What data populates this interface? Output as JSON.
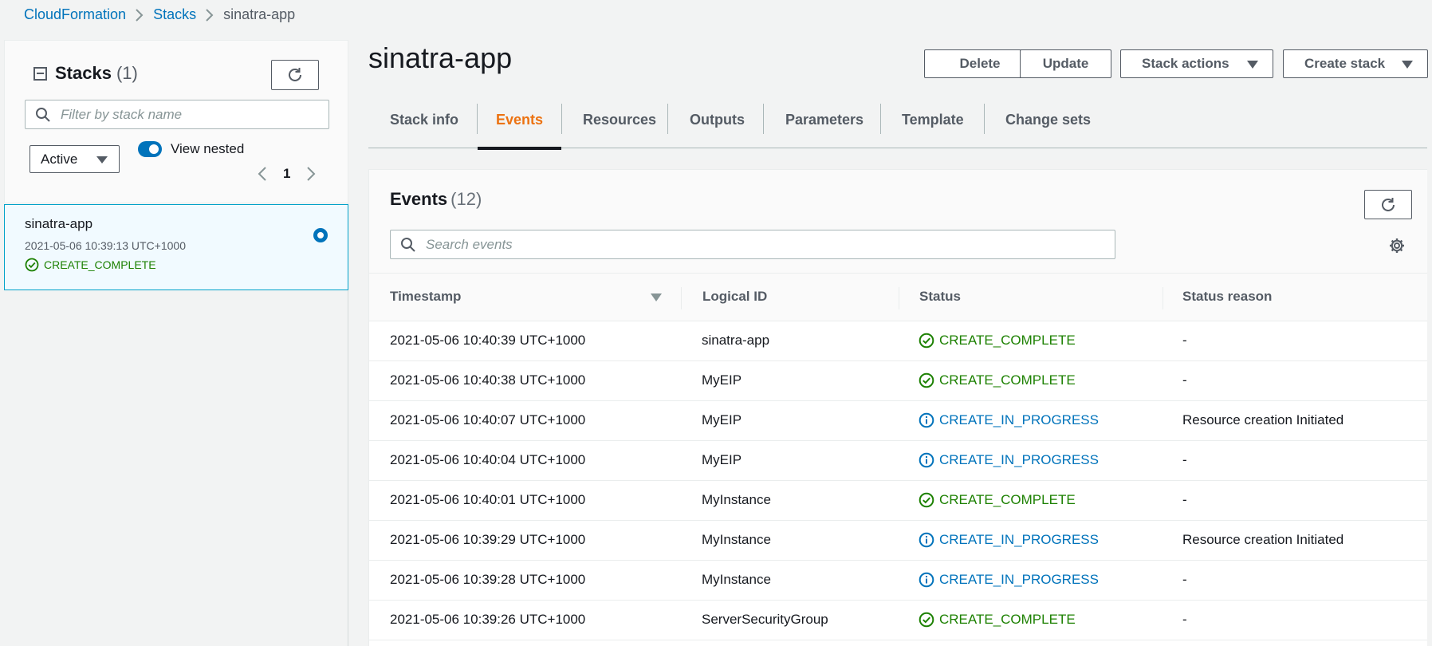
{
  "breadcrumb": {
    "items": [
      "CloudFormation",
      "Stacks",
      "sinatra-app"
    ]
  },
  "sidebar": {
    "title": "Stacks",
    "count": "(1)",
    "search_placeholder": "Filter by stack name",
    "filter_value": "Active",
    "toggle_label": "View nested",
    "toggle_on": true,
    "page_number": "1",
    "stack": {
      "name": "sinatra-app",
      "date": "2021-05-06 10:39:13 UTC+1000",
      "status": "CREATE_COMPLETE",
      "selected": true
    }
  },
  "header": {
    "title": "sinatra-app",
    "buttons": {
      "delete": "Delete",
      "update": "Update",
      "stack_actions": "Stack actions",
      "create_stack": "Create stack"
    }
  },
  "tabs": [
    "Stack info",
    "Events",
    "Resources",
    "Outputs",
    "Parameters",
    "Template",
    "Change sets"
  ],
  "active_tab": "Events",
  "events": {
    "title": "Events",
    "count": "(12)",
    "search_placeholder": "Search events",
    "columns": [
      "Timestamp",
      "Logical ID",
      "Status",
      "Status reason"
    ],
    "rows": [
      {
        "timestamp": "2021-05-06 10:40:39 UTC+1000",
        "logical_id": "sinatra-app",
        "status": "CREATE_COMPLETE",
        "reason": "-"
      },
      {
        "timestamp": "2021-05-06 10:40:38 UTC+1000",
        "logical_id": "MyEIP",
        "status": "CREATE_COMPLETE",
        "reason": "-"
      },
      {
        "timestamp": "2021-05-06 10:40:07 UTC+1000",
        "logical_id": "MyEIP",
        "status": "CREATE_IN_PROGRESS",
        "reason": "Resource creation Initiated"
      },
      {
        "timestamp": "2021-05-06 10:40:04 UTC+1000",
        "logical_id": "MyEIP",
        "status": "CREATE_IN_PROGRESS",
        "reason": "-"
      },
      {
        "timestamp": "2021-05-06 10:40:01 UTC+1000",
        "logical_id": "MyInstance",
        "status": "CREATE_COMPLETE",
        "reason": "-"
      },
      {
        "timestamp": "2021-05-06 10:39:29 UTC+1000",
        "logical_id": "MyInstance",
        "status": "CREATE_IN_PROGRESS",
        "reason": "Resource creation Initiated"
      },
      {
        "timestamp": "2021-05-06 10:39:28 UTC+1000",
        "logical_id": "MyInstance",
        "status": "CREATE_IN_PROGRESS",
        "reason": "-"
      },
      {
        "timestamp": "2021-05-06 10:39:26 UTC+1000",
        "logical_id": "ServerSecurityGroup",
        "status": "CREATE_COMPLETE",
        "reason": "-"
      }
    ]
  },
  "colors": {
    "link": "#0073bb",
    "active_tab": "#ec7211",
    "success": "#1d8102",
    "info": "#0073bb",
    "selected_bg": "#f1faff",
    "selected_border": "#00a1c9"
  }
}
